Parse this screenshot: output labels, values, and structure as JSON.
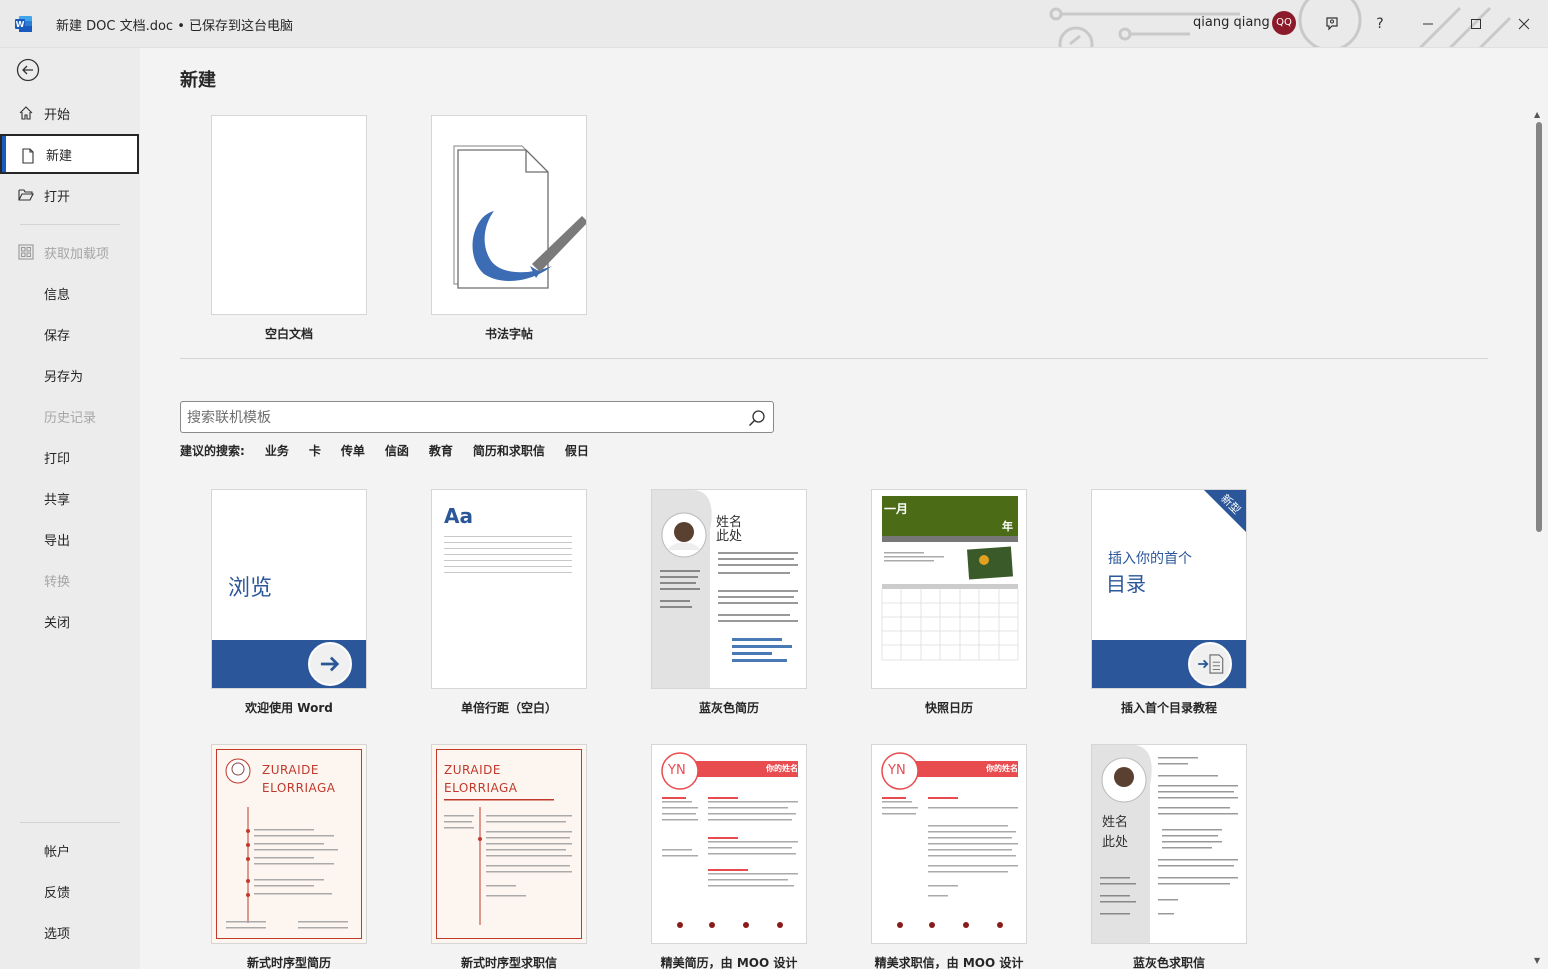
{
  "titlebar": {
    "doc_title": "新建 DOC 文档.doc • 已保存到这台电脑",
    "user_name": "qiang qiang",
    "avatar_initials": "QQ",
    "help": "?"
  },
  "sidebar": {
    "items": [
      {
        "label": "开始",
        "icon": "home-icon"
      },
      {
        "label": "新建",
        "icon": "new-document-icon"
      },
      {
        "label": "打开",
        "icon": "folder-open-icon"
      },
      {
        "label": "获取加载项",
        "icon": "addins-grid-icon"
      },
      {
        "label": "信息"
      },
      {
        "label": "保存"
      },
      {
        "label": "另存为"
      },
      {
        "label": "历史记录"
      },
      {
        "label": "打印"
      },
      {
        "label": "共享"
      },
      {
        "label": "导出"
      },
      {
        "label": "转换"
      },
      {
        "label": "关闭"
      }
    ],
    "bottom": [
      {
        "label": "帐户"
      },
      {
        "label": "反馈"
      },
      {
        "label": "选项"
      }
    ]
  },
  "main": {
    "title": "新建",
    "top_templates": [
      {
        "label": "空白文档"
      },
      {
        "label": "书法字帖"
      }
    ],
    "search": {
      "placeholder": "搜索联机模板"
    },
    "suggested": {
      "label": "建议的搜索:",
      "links": [
        "业务",
        "卡",
        "传单",
        "信函",
        "教育",
        "简历和求职信",
        "假日"
      ]
    },
    "templates_row1": [
      {
        "label": "欢迎使用 Word",
        "thumb_text": "浏览"
      },
      {
        "label": "单倍行距（空白）",
        "thumb_text": "Aa"
      },
      {
        "label": "蓝灰色简历",
        "thumb_text_1": "姓名",
        "thumb_text_2": "此处"
      },
      {
        "label": "快照日历",
        "thumb_text_1": "一月",
        "thumb_text_2": "年"
      },
      {
        "label": "插入首个目录教程",
        "thumb_text_1": "插入你的首个",
        "thumb_text_2": "目录",
        "badge": "新型"
      }
    ],
    "templates_row2": [
      {
        "label": "新式时序型简历",
        "thumb_text_1": "ZURAIDE",
        "thumb_text_2": "ELORRIAGA"
      },
      {
        "label": "新式时序型求职信",
        "thumb_text_1": "ZURAIDE",
        "thumb_text_2": "ELORRIAGA"
      },
      {
        "label": "精美简历，由 MOO 设计",
        "thumb_text_1": "YN",
        "thumb_text_2": "你的姓名"
      },
      {
        "label": "精美求职信，由 MOO 设计",
        "thumb_text_1": "YN",
        "thumb_text_2": "你的姓名"
      },
      {
        "label": "蓝灰色求职信",
        "thumb_text_1": "姓名",
        "thumb_text_2": "此处"
      }
    ]
  },
  "colors": {
    "word_blue": "#2b579a",
    "accent_red": "#e84c4f",
    "avatar_bg": "#8b1a2b",
    "calendar_green": "#4c6b16"
  }
}
